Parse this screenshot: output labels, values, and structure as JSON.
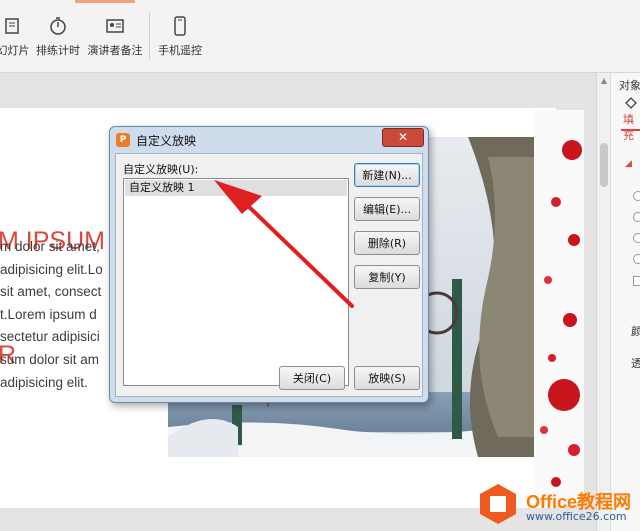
{
  "toolbar": {
    "items": [
      {
        "label": "幻灯片",
        "icon": "slides-icon"
      },
      {
        "label": "排练计时",
        "icon": "stopwatch-icon"
      },
      {
        "label": "演讲者备注",
        "icon": "presenter-notes-icon"
      },
      {
        "label": "手机遥控",
        "icon": "phone-remote-icon"
      }
    ]
  },
  "slide": {
    "title_lines": [
      "M IPSUM",
      "R"
    ],
    "body": "m dolor sit amet,\nadipisicing elit.Lo\nsit amet, consect\nt.Lorem ipsum d\nsectetur adipisici\nsum dolor sit am\nadipisicing elit."
  },
  "dialog": {
    "title": "自定义放映",
    "close_label": "✕",
    "list_label": "自定义放映(U):",
    "items": [
      "自定义放映 1"
    ],
    "buttons": {
      "new": "新建(N)...",
      "edit": "编辑(E)...",
      "delete": "删除(R)",
      "copy": "复制(Y)",
      "close": "关闭(C)",
      "show": "放映(S)"
    }
  },
  "side_pane": {
    "title": "对象",
    "tab": "填充",
    "labels": [
      "颜",
      "透"
    ]
  },
  "watermark": {
    "brand": "Office教程网",
    "url": "www.office26.com"
  },
  "colors": {
    "accent_red": "#d9473d",
    "arrow_red": "#e02020",
    "dialog_frame": "#cfdcec",
    "brand_orange": "#ff7a00"
  }
}
